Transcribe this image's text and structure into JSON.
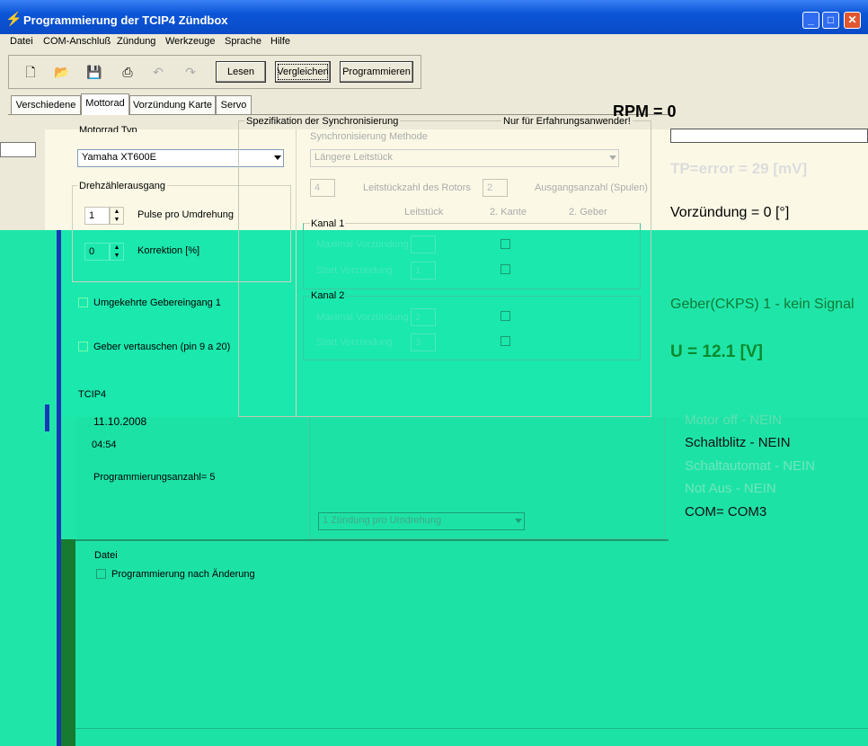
{
  "window": {
    "title": "Programmierung der TCIP4 Zündbox",
    "icon": "app-spark-icon",
    "controls": [
      "_",
      "□",
      "✕"
    ]
  },
  "menu": [
    "Datei",
    "COM-Anschluß",
    "Zündung",
    "Werkzeuge",
    "Sprache",
    "Hilfe"
  ],
  "toolbar": {
    "icons": [
      "new-file-icon",
      "open-folder-icon",
      "save-disk-icon",
      "print-icon",
      "undo-icon",
      "redo-icon"
    ],
    "lesen": "Lesen",
    "vergleichen": "Vergleichen",
    "programmieren": "Programmieren"
  },
  "tabs": [
    "Verschiedene",
    "Mottorad",
    "Vorzündung Karte",
    "Servo"
  ],
  "status": {
    "rpm": "RPM = 0",
    "tp": "TP=error = 29 [mV]",
    "vorzuendung": "Vorzündung = 0 [°]",
    "geber": "Geber(CKPS) 1 - kein Signal",
    "u": "U = 12.1 [V]",
    "motor_off": "Motor off - NEIN",
    "schaltblitz": "Schaltblitz - NEIN",
    "schaltautomat": "Schaltautomat - NEIN",
    "not_aus": "Not Aus - NEIN",
    "com": "COM= COM3"
  },
  "motorrad": {
    "typ_label": "Motorrad Typ",
    "typ_value": "Yamaha XT600E",
    "drehzahl_group": "Drehzählerausgang",
    "pulse_value": "1",
    "pulse_label": "Pulse pro Umdrehung",
    "korrektion_value": "0",
    "korrektion_label": "Korrektion [%]",
    "umgekehrte": "Umgekehrte Gebereingang 1",
    "geber_vertauschen": "Geber vertauschen (pin 9 a 20)",
    "tcip4": "TCIP4",
    "date": "11.10.2008",
    "time": "04:54",
    "prog_count": "Programmierungsanzahl= 5"
  },
  "sync": {
    "group": "Spezifikation der Synchronisierung",
    "expert": "Nur für Erfahrungsanwender!",
    "methode_label": "Synchronisierung Methode",
    "methode_value": "Längere Leitstück",
    "leitstueck_value": "4",
    "leitstueck_label": "Leitstückzahl des Rotors",
    "ausgang_value": "2",
    "ausgang_label": "Ausgangsanzahl (Spulen)",
    "col_leitstueck": "Leitstück",
    "col_kante": "2. Kante",
    "col_geber": "2. Geber",
    "kanal1": "Kanal 1",
    "kanal2": "Kanal 2",
    "max_vz": "Maximal Vorzündung",
    "start_vz": "Start Vorzündung",
    "k1_start": "1",
    "k2_max": "2",
    "k2_start": "3",
    "zuendung": "1 Zündung pro Umdrehung"
  },
  "datei": {
    "label": "Datei",
    "prog_nach": "Programmierung nach Änderung"
  }
}
